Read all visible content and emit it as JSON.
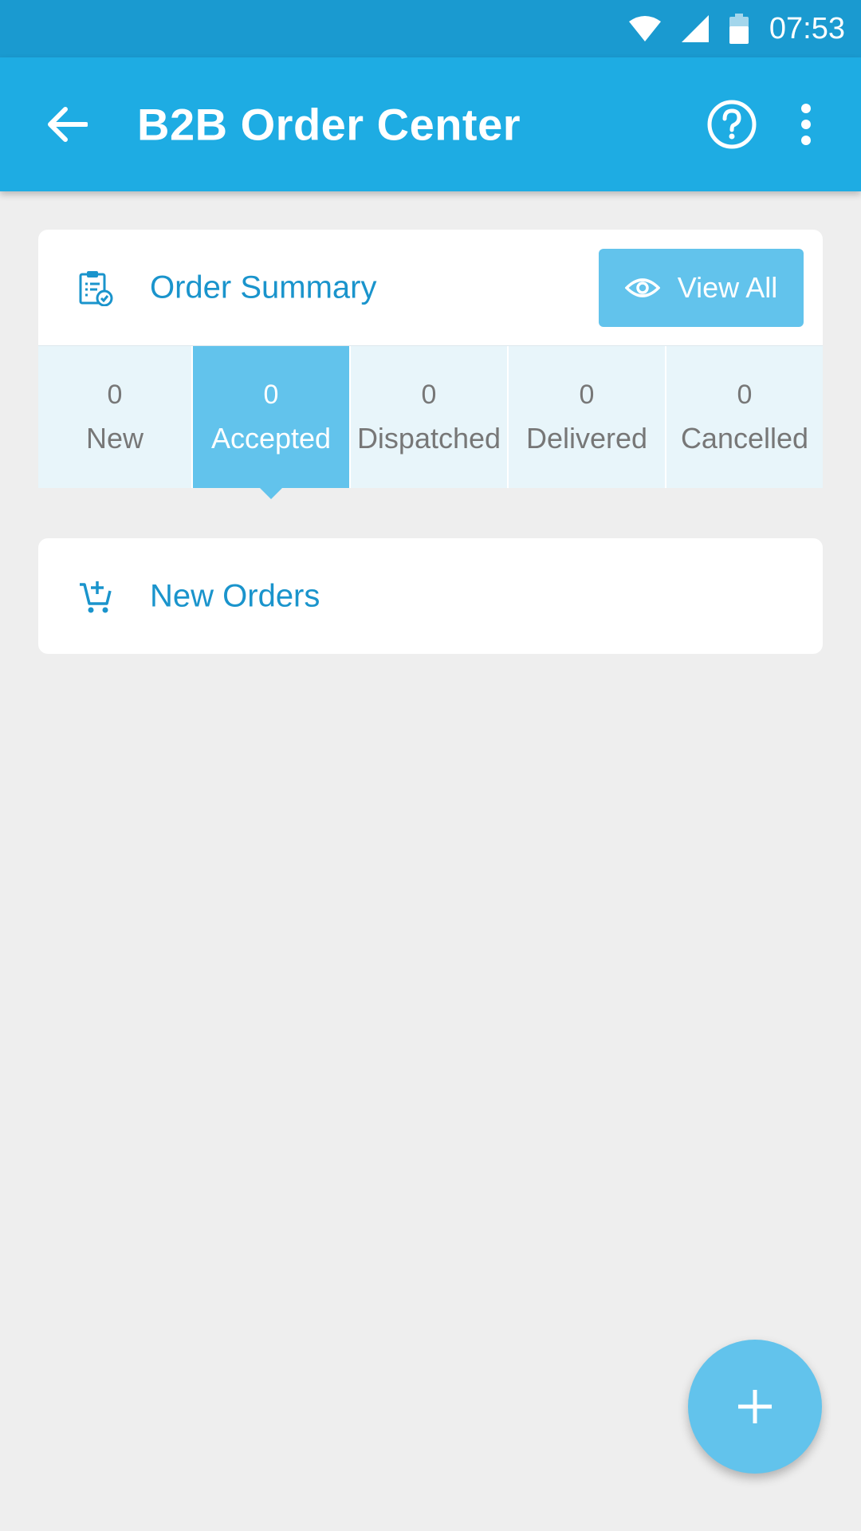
{
  "status_bar": {
    "time": "07:53",
    "icons": [
      "wifi-icon",
      "signal-icon",
      "battery-icon"
    ]
  },
  "app_bar": {
    "title": "B2B Order Center",
    "icons": [
      "back-arrow-icon",
      "help-icon",
      "more-vert-icon"
    ]
  },
  "summary": {
    "title": "Order Summary",
    "view_all_label": "View All",
    "icon": "clipboard-check-icon",
    "tabs": [
      {
        "count": "0",
        "label": "New",
        "active": false
      },
      {
        "count": "0",
        "label": "Accepted",
        "active": true
      },
      {
        "count": "0",
        "label": "Dispatched",
        "active": false
      },
      {
        "count": "0",
        "label": "Delivered",
        "active": false
      },
      {
        "count": "0",
        "label": "Cancelled",
        "active": false
      }
    ]
  },
  "new_orders": {
    "title": "New Orders",
    "icon": "cart-add-icon"
  },
  "fab": {
    "icon": "plus-icon"
  },
  "colors": {
    "status_bar": "#1a9ad0",
    "app_bar": "#1eace3",
    "accent": "#62c3ec",
    "text_blue": "#1a94cc",
    "tab_bg": "#e8f5fa",
    "background": "#eeeeee"
  }
}
